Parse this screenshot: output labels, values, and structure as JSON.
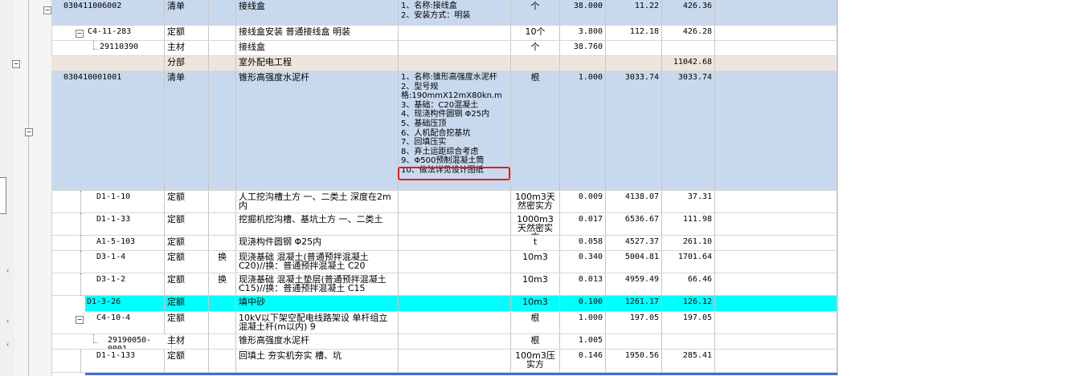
{
  "colors": {
    "qingdan_row": "#c8d9ee",
    "fenbu_row": "#ede6df",
    "selected_row": "#00ffff",
    "highlight_box": "#e21b1b"
  },
  "rows": [
    {
      "code": "030411006002",
      "type": "清单",
      "swap": "",
      "name": "接线盒",
      "features": "1、名称:接线盒\n2、安装方式：明装",
      "unit": "个",
      "qty": "38.000",
      "price": "11.22",
      "total": "426.36"
    },
    {
      "code": "C4-11-283",
      "type": "定额",
      "swap": "",
      "name": "接线盒安装 普通接线盒 明装",
      "features": "",
      "unit": "10个",
      "qty": "3.800",
      "price": "112.18",
      "total": "426.28"
    },
    {
      "code": "29110390",
      "type": "主材",
      "swap": "",
      "name": "接线盒",
      "features": "",
      "unit": "个",
      "qty": "38.760",
      "price": "",
      "total": ""
    },
    {
      "code": "",
      "type": "分部",
      "swap": "",
      "name": "室外配电工程",
      "features": "",
      "unit": "",
      "qty": "",
      "price": "",
      "total": "11042.68"
    },
    {
      "code": "030410001001",
      "type": "清单",
      "swap": "",
      "name": "锥形高强度水泥杆",
      "features": "1、名称:锥形高强度水泥杆\n2、型号规格:190mmX12mX80kn.m\n3、基础：C20混凝土\n4、现浇构件圆钢 Φ25内\n5、基础压顶\n6、人机配合挖基坑\n7、回填压实\n8、弃土运距综合考虑\n9、Φ500预制混凝土筒\n10、做法详见设计图纸",
      "unit": "根",
      "qty": "1.000",
      "price": "3033.74",
      "total": "3033.74"
    },
    {
      "code": "D1-1-10",
      "type": "定额",
      "swap": "",
      "name": "人工挖沟槽土方 一、二类土 深度在2m内",
      "features": "",
      "unit": "100m3天然密实方",
      "qty": "0.009",
      "price": "4138.07",
      "total": "37.31"
    },
    {
      "code": "D1-1-33",
      "type": "定额",
      "swap": "",
      "name": "挖掘机挖沟槽、基坑土方 一、二类土",
      "features": "",
      "unit": "1000m3天然密实方",
      "qty": "0.017",
      "price": "6536.67",
      "total": "111.98"
    },
    {
      "code": "A1-5-103",
      "type": "定额",
      "swap": "",
      "name": "现浇构件圆钢 Φ25内",
      "features": "",
      "unit": "t",
      "qty": "0.058",
      "price": "4527.37",
      "total": "261.10"
    },
    {
      "code": "D3-1-4",
      "type": "定额",
      "swap": "换",
      "name": "现浇基础 混凝土(普通预拌混凝土C20)//换：普通预拌混凝土 C20",
      "features": "",
      "unit": "10m3",
      "qty": "0.340",
      "price": "5004.81",
      "total": "1701.64"
    },
    {
      "code": "D3-1-2",
      "type": "定额",
      "swap": "换",
      "name": "现浇基础 混凝土垫层(普通预拌混凝土 C15)//换：普通预拌混凝土 C15",
      "features": "",
      "unit": "10m3",
      "qty": "0.013",
      "price": "4959.49",
      "total": "66.46"
    },
    {
      "code": "D1-3-26",
      "type": "定额",
      "swap": "",
      "name": "填中砂",
      "features": "",
      "unit": "10m3",
      "qty": "0.100",
      "price": "1261.17",
      "total": "126.12"
    },
    {
      "code": "C4-10-4",
      "type": "定额",
      "swap": "",
      "name": "10kV以下架空配电线路架设 单杆组立 混凝土杆(m以内) 9",
      "features": "",
      "unit": "根",
      "qty": "1.000",
      "price": "197.05",
      "total": "197.05"
    },
    {
      "code": "29190050-0001",
      "type": "主材",
      "swap": "",
      "name": "锥形高强度水泥杆",
      "features": "",
      "unit": "根",
      "qty": "1.005",
      "price": "",
      "total": ""
    },
    {
      "code": "D1-1-133",
      "type": "定额",
      "swap": "",
      "name": "回填土 夯实机夯实 槽、坑",
      "features": "",
      "unit": "100m3压实方",
      "qty": "0.146",
      "price": "1950.56",
      "total": "285.41"
    }
  ]
}
